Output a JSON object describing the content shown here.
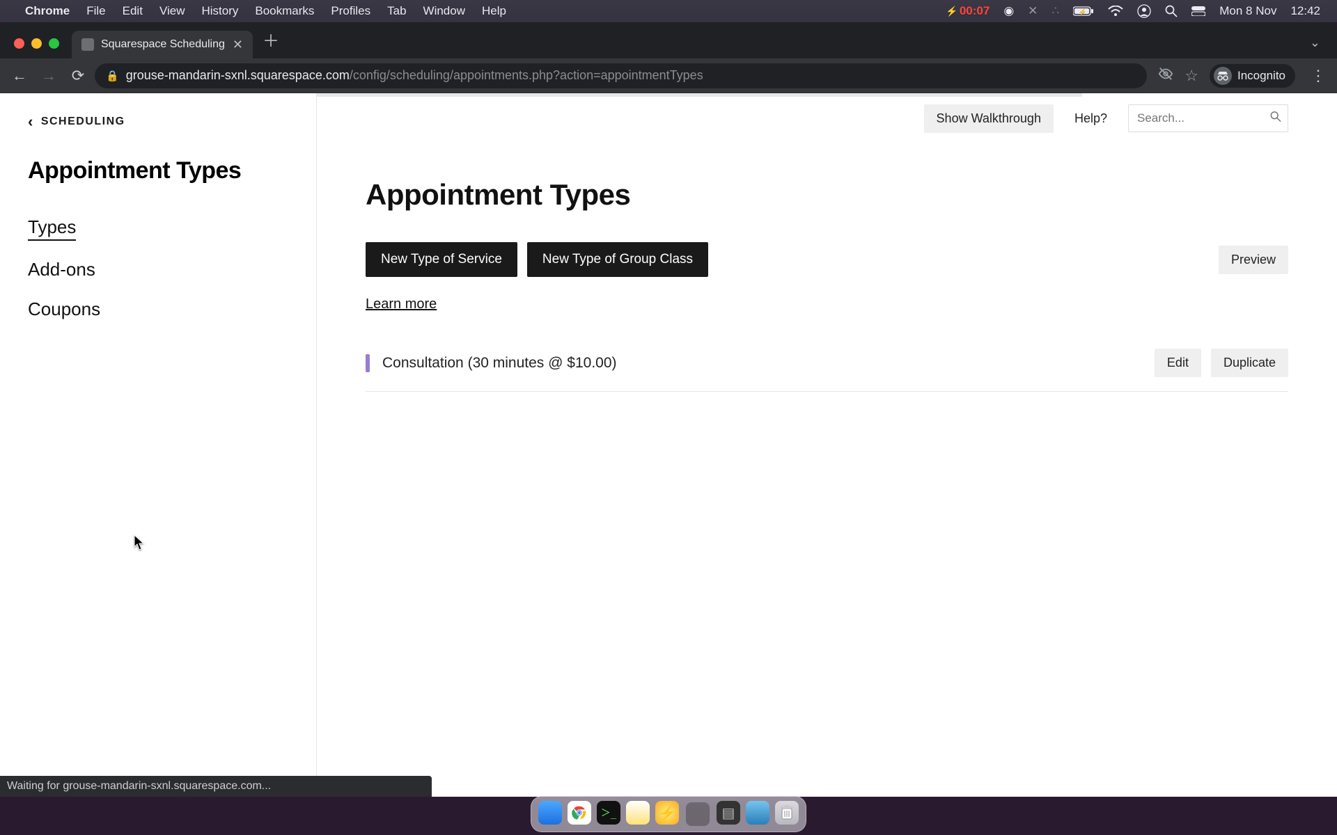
{
  "mac": {
    "app": "Chrome",
    "menus": [
      "File",
      "Edit",
      "View",
      "History",
      "Bookmarks",
      "Profiles",
      "Tab",
      "Window",
      "Help"
    ],
    "battery_timer": "00:07",
    "date": "Mon 8 Nov",
    "time": "12:42"
  },
  "browser": {
    "tab_title": "Squarespace Scheduling",
    "url_host": "grouse-mandarin-sxnl.squarespace.com",
    "url_path": "/config/scheduling/appointments.php?action=appointmentTypes",
    "incognito_label": "Incognito",
    "status_text": "Waiting for grouse-mandarin-sxnl.squarespace.com..."
  },
  "sidebar": {
    "back_label": "SCHEDULING",
    "heading": "Appointment Types",
    "nav": {
      "types": "Types",
      "addons": "Add-ons",
      "coupons": "Coupons"
    }
  },
  "toolbar": {
    "walkthrough": "Show Walkthrough",
    "help": "Help?",
    "search_placeholder": "Search..."
  },
  "main": {
    "title": "Appointment Types",
    "new_service": "New Type of Service",
    "new_group": "New Type of Group Class",
    "preview": "Preview",
    "learn_more": "Learn more",
    "appointments": [
      {
        "label": "Consultation (30 minutes @ $10.00)",
        "color": "#9b7bd4",
        "edit": "Edit",
        "duplicate": "Duplicate"
      }
    ]
  }
}
